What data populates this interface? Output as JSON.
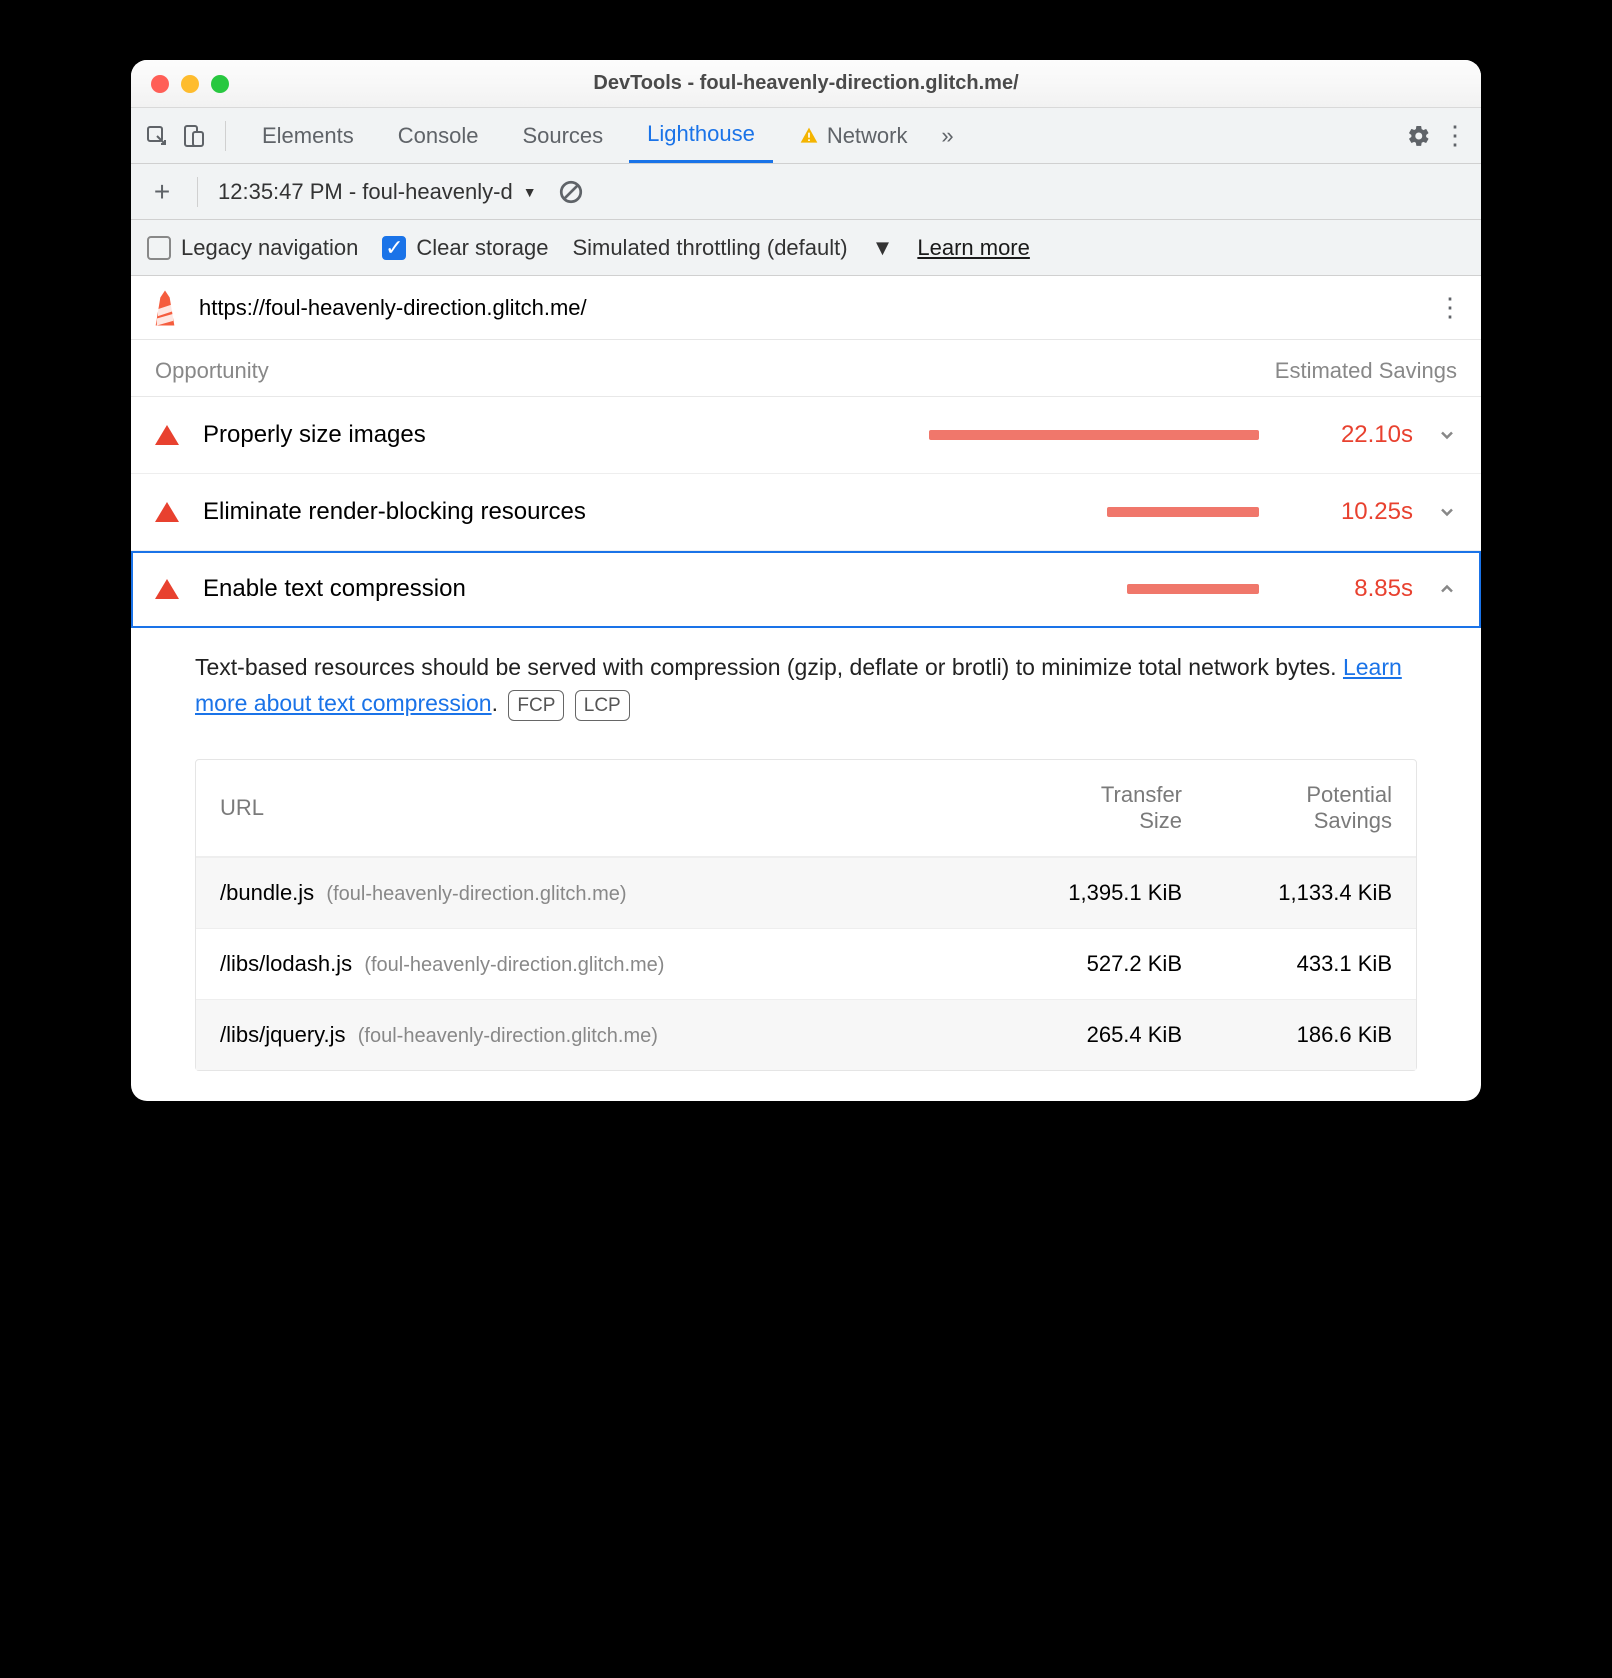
{
  "title": "DevTools - foul-heavenly-direction.glitch.me/",
  "tabs": {
    "elements": "Elements",
    "console": "Console",
    "sources": "Sources",
    "lighthouse": "Lighthouse",
    "network": "Network"
  },
  "subbar": {
    "report_label": "12:35:47 PM - foul-heavenly-d"
  },
  "options": {
    "legacy": "Legacy navigation",
    "clear": "Clear storage",
    "throttling": "Simulated throttling (default)",
    "learn": "Learn more"
  },
  "url": "https://foul-heavenly-direction.glitch.me/",
  "headers": {
    "opportunity": "Opportunity",
    "est_savings": "Estimated Savings"
  },
  "opportunities": [
    {
      "label": "Properly size images",
      "savings": "22.10s",
      "bar_pct": 100,
      "expanded": false
    },
    {
      "label": "Eliminate render-blocking resources",
      "savings": "10.25s",
      "bar_pct": 46,
      "expanded": false
    },
    {
      "label": "Enable text compression",
      "savings": "8.85s",
      "bar_pct": 40,
      "expanded": true
    }
  ],
  "detail": {
    "text_a": "Text-based resources should be served with compression (gzip, deflate or brotli) to minimize total network bytes. ",
    "link": "Learn more about text compression",
    "tags": [
      "FCP",
      "LCP"
    ]
  },
  "table": {
    "h_url": "URL",
    "h_ts": "Transfer Size",
    "h_ps": "Potential Savings",
    "rows": [
      {
        "path": "/bundle.js",
        "host": "(foul-heavenly-direction.glitch.me)",
        "ts": "1,395.1 KiB",
        "ps": "1,133.4 KiB"
      },
      {
        "path": "/libs/lodash.js",
        "host": "(foul-heavenly-direction.glitch.me)",
        "ts": "527.2 KiB",
        "ps": "433.1 KiB"
      },
      {
        "path": "/libs/jquery.js",
        "host": "(foul-heavenly-direction.glitch.me)",
        "ts": "265.4 KiB",
        "ps": "186.6 KiB"
      }
    ]
  }
}
